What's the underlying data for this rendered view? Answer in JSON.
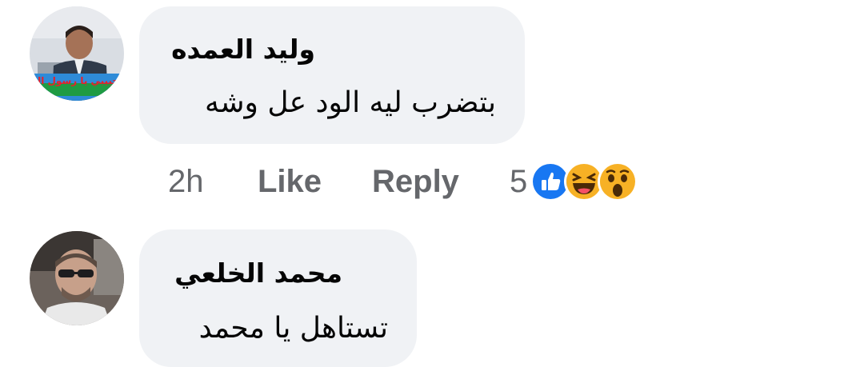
{
  "comments": [
    {
      "author": "وليد العمده",
      "text": "بتضرب ليه الود عل وشه",
      "avatar_banner_text": "حبيبي يا رسول الله"
    },
    {
      "author": "محمد الخلعي",
      "text": "تستاهل يا محمد"
    }
  ],
  "actions": {
    "time": "2h",
    "like_label": "Like",
    "reply_label": "Reply",
    "reaction_count": "5",
    "reactions": [
      "like-icon",
      "haha-icon",
      "wow-icon"
    ]
  },
  "colors": {
    "bubble_bg": "#f0f2f5",
    "secondary_text": "#65676b",
    "like_blue": "#1877f2",
    "emoji_yellow": "#f7b125"
  }
}
